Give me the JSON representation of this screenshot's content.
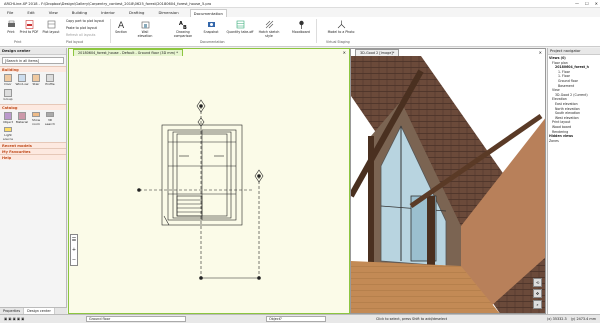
{
  "titlebar": {
    "title": "ARCHLine.XP 2018 - F:\\Dropbox\\Design\\Gallery\\Carpentry_contest_2018\\0625_forest\\20180604_forest_house_5.pro",
    "min": "—",
    "max": "☐",
    "close": "✕"
  },
  "menu": [
    "File",
    "Edit",
    "View",
    "Building",
    "Interior",
    "Drafting",
    "Dimension",
    "Documentation"
  ],
  "menu_active": "Documentation",
  "ribbon": {
    "print": {
      "label": "Print"
    },
    "print_pdf": {
      "label": "Print to PDF"
    },
    "plot_layout": {
      "label": "Plot layout"
    },
    "copy_plot": "Copy part to plot layout",
    "paste_plot": "Paste to plot layout",
    "refresh_layout": "Refresh all layouts",
    "group_print": "Print",
    "group_plot": "Plot layout",
    "section": {
      "label": "Section"
    },
    "wall_elevation": {
      "label": "Wall elevation"
    },
    "drawing_comparison": {
      "label": "Drawing comparison"
    },
    "snapshot": {
      "label": "Snapshot"
    },
    "quantity_take_off": {
      "label": "Quantity take-off"
    },
    "hatch_sketch": {
      "label": "Hatch sketch style"
    },
    "moodboard": {
      "label": "Moodboard"
    },
    "group_documentation": "Documentation",
    "model_to_photo": {
      "label": "Model to a Photo"
    },
    "group_virtual": "Virtual Staging"
  },
  "left_panel": {
    "title": "Design center",
    "search_placeholder": "[Search in all items]",
    "sections": [
      {
        "label": "Building",
        "tools": [
          "Door",
          "Wind-ow",
          "Stair",
          "Profile",
          "Group"
        ]
      },
      {
        "label": "Catalog",
        "tools": [
          "Object",
          "Material",
          "Show room",
          "3D search",
          "Light source"
        ]
      },
      {
        "label": "Recent models",
        "tools": []
      },
      {
        "label": "My Favourites",
        "tools": []
      },
      {
        "label": "Help",
        "tools": []
      }
    ],
    "bottom_tabs": [
      "Properties",
      "Design center"
    ]
  },
  "plan_view": {
    "tab": "20180604_forest_house - Default - Ground floor (3D mm) *",
    "close": "✕"
  },
  "view3d": {
    "tab": "3D-Good 2 [Image]*",
    "close": "✕"
  },
  "navigator": {
    "title": "Project navigator",
    "items": [
      {
        "label": "Views (0)",
        "level": 0,
        "bold": true
      },
      {
        "label": "Floor plan",
        "level": 1
      },
      {
        "label": "20180604_forest_h",
        "level": 2,
        "bold": true
      },
      {
        "label": "1. Floor",
        "level": 3
      },
      {
        "label": "1. Floor",
        "level": 3
      },
      {
        "label": "Ground floor",
        "level": 3
      },
      {
        "label": "Basement",
        "level": 3
      },
      {
        "label": "View",
        "level": 1
      },
      {
        "label": "3D-Good 2 (Current)",
        "level": 2
      },
      {
        "label": "Elevation",
        "level": 1
      },
      {
        "label": "East elevation",
        "level": 2
      },
      {
        "label": "North elevation",
        "level": 2
      },
      {
        "label": "South elevation",
        "level": 2
      },
      {
        "label": "West elevation",
        "level": 2
      },
      {
        "label": "Print layout",
        "level": 1
      },
      {
        "label": "Wood board",
        "level": 1
      },
      {
        "label": "Rendering",
        "level": 1
      },
      {
        "label": "Hidden views",
        "level": 0,
        "bold": true
      },
      {
        "label": "Zones",
        "level": 0
      }
    ]
  },
  "statusbar": {
    "floor": "Ground floor",
    "object": "Object?",
    "hint": "Click to select, press Shift to add/deselect",
    "coords": "(x) 35332.3",
    "coords2": "(y) 2473.4 mm"
  },
  "colors": {
    "accent": "#c04a1a",
    "plan_border": "#8cc63f",
    "plan_bg": "#fbfbe8"
  }
}
